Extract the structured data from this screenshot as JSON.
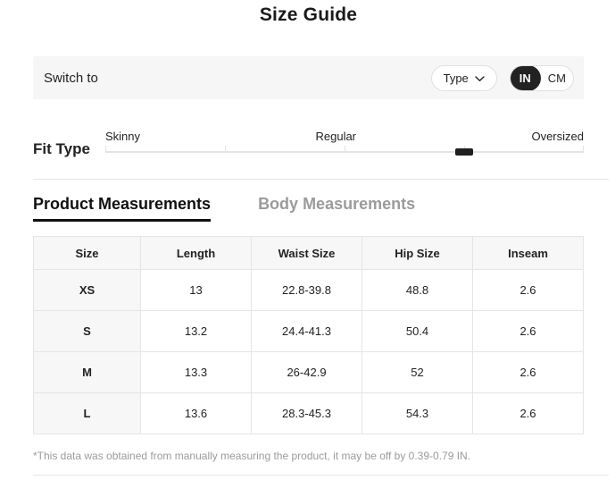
{
  "page": {
    "title": "Size Guide"
  },
  "switch_bar": {
    "label": "Switch to",
    "type_button": {
      "label": "Type"
    },
    "unit_toggle": {
      "options": [
        "IN",
        "CM"
      ],
      "selected": "IN"
    }
  },
  "fit_type": {
    "label": "Fit Type",
    "scale_labels": [
      "Skinny",
      "Regular",
      "Oversized"
    ],
    "marker_position_percent": 75
  },
  "tabs": [
    {
      "label": "Product Measurements",
      "active": true
    },
    {
      "label": "Body Measurements",
      "active": false
    }
  ],
  "table": {
    "headers": [
      "Size",
      "Length",
      "Waist Size",
      "Hip Size",
      "Inseam"
    ],
    "rows": [
      [
        "XS",
        "13",
        "22.8-39.8",
        "48.8",
        "2.6"
      ],
      [
        "S",
        "13.2",
        "24.4-41.3",
        "50.4",
        "2.6"
      ],
      [
        "M",
        "13.3",
        "26-42.9",
        "52",
        "2.6"
      ],
      [
        "L",
        "13.6",
        "28.3-45.3",
        "54.3",
        "2.6"
      ]
    ]
  },
  "footnote": "*This data was obtained from manually measuring the product, it may be off by 0.39-0.79 IN.",
  "colors": {
    "accent": "#222222",
    "muted": "#9b9b9b",
    "border": "#e5e5e5",
    "bar_background": "#f6f6f6",
    "table_header_background": "#f7f7f7"
  }
}
